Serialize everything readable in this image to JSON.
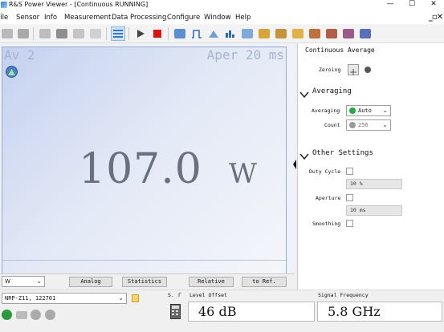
{
  "window": {
    "title": "R&S Power Viewer - [Continuous  RUNNING]",
    "minimize": "—",
    "maximize": "☐",
    "close": "✕"
  },
  "menu": [
    "File",
    "Sensor",
    "Info",
    "Measurement",
    "Data Processing",
    "Configure",
    "Window",
    "Help"
  ],
  "mdi_controls": "_▫✕",
  "display": {
    "channel": "Av 2",
    "aperture": "Aper 20 ms",
    "value": "107.0",
    "unit": "W"
  },
  "bottom_bar": {
    "unit_select": "W",
    "analog": "Analog",
    "statistics": "Statistics",
    "relative": "Relative",
    "to_ref": "to Ref."
  },
  "right_panel": {
    "title": "Continuous Average",
    "zeroing_label": "Zeroing",
    "averaging_section": "Averaging",
    "averaging_label": "Averaging",
    "averaging_value": "Auto",
    "count_label": "Count",
    "count_value": "256",
    "other_section": "Other Settings",
    "duty_cycle_label": "Duty Cycle",
    "duty_cycle_value": "10 %",
    "aperture_label": "Aperture",
    "aperture_value": "10 ms",
    "smoothing_label": "Smoothing"
  },
  "status": {
    "sensor": "NRP-Z11, 122701",
    "s_label": "S.",
    "gamma_label": "Γ",
    "level_offset_label": "Level Offset",
    "level_offset_value": "46 dB",
    "signal_frequency_label": "Signal Frequency",
    "signal_frequency_value": "5.8 GHz"
  },
  "colors": {
    "display_gradient_start": "#c4d1ef",
    "value_text": "#6b7080",
    "run_indicator": "#22aa44",
    "stop_indicator": "#d11"
  }
}
